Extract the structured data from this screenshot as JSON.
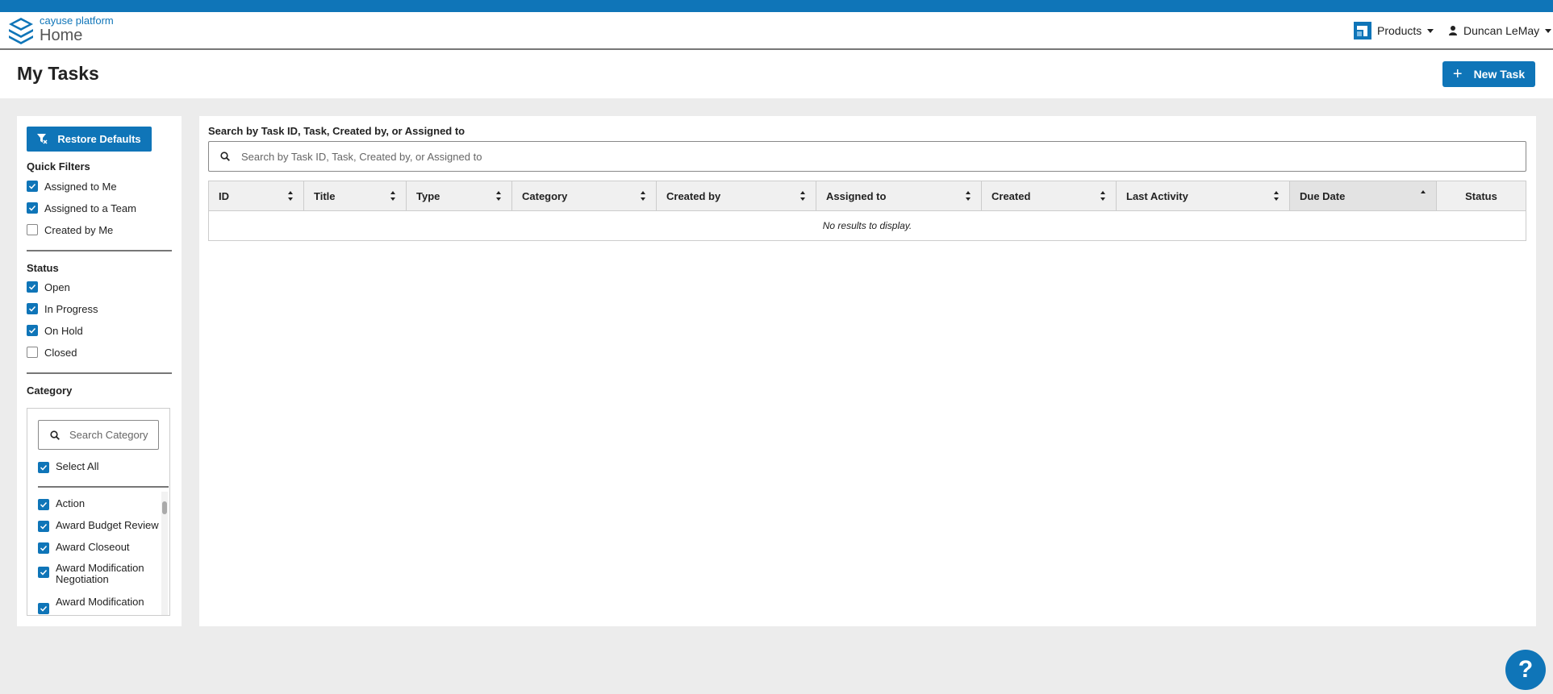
{
  "colors": {
    "accent": "#0f75b8",
    "page_bg": "#ececec",
    "header_border": "#777777"
  },
  "header": {
    "brand_name": "cayuse platform",
    "brand_sub": "Home",
    "logo_icon": "stacked-layers-icon",
    "products_icon": "cayuse-products-icon",
    "products_label": "Products",
    "user_icon": "user-icon",
    "user_name": "Duncan LeMay"
  },
  "page": {
    "title": "My Tasks",
    "new_task_label": "New Task",
    "new_task_icon": "plus-icon"
  },
  "sidebar": {
    "restore_label": "Restore Defaults",
    "restore_icon": "filter-reset-icon",
    "quick_filters": {
      "title": "Quick Filters",
      "items": [
        {
          "label": "Assigned to Me",
          "checked": true
        },
        {
          "label": "Assigned to a Team",
          "checked": true
        },
        {
          "label": "Created by Me",
          "checked": false
        }
      ]
    },
    "status": {
      "title": "Status",
      "items": [
        {
          "label": "Open",
          "checked": true
        },
        {
          "label": "In Progress",
          "checked": true
        },
        {
          "label": "On Hold",
          "checked": true
        },
        {
          "label": "Closed",
          "checked": false
        }
      ]
    },
    "category": {
      "title": "Category",
      "search_placeholder": "Search Category",
      "search_value": "",
      "select_all_label": "Select All",
      "select_all_checked": true,
      "items": [
        {
          "label": "Action",
          "checked": true
        },
        {
          "label": "Award Budget Review",
          "checked": true
        },
        {
          "label": "Award Closeout",
          "checked": true
        },
        {
          "label": "Award Modification Negotiation",
          "checked": true
        },
        {
          "label": "Award Modification",
          "checked": true
        }
      ]
    }
  },
  "main": {
    "search_label": "Search by Task ID, Task, Created by, or Assigned to",
    "search_placeholder": "Search by Task ID, Task, Created by, or Assigned to",
    "search_value": "",
    "columns": [
      {
        "label": "ID",
        "sort": "none"
      },
      {
        "label": "Title",
        "sort": "none"
      },
      {
        "label": "Type",
        "sort": "none"
      },
      {
        "label": "Category",
        "sort": "none"
      },
      {
        "label": "Created by",
        "sort": "none"
      },
      {
        "label": "Assigned to",
        "sort": "none"
      },
      {
        "label": "Created",
        "sort": "none"
      },
      {
        "label": "Last Activity",
        "sort": "none"
      },
      {
        "label": "Due Date",
        "sort": "ascending"
      },
      {
        "label": "Status",
        "sort": "unsortable"
      }
    ],
    "empty_message": "No results to display."
  },
  "help": {
    "label": "?",
    "icon": "help-icon"
  }
}
